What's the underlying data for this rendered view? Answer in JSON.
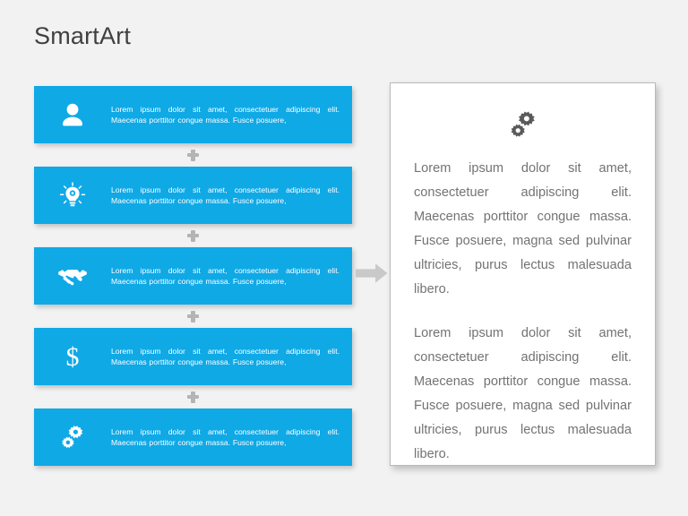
{
  "slide": {
    "title": "SmartArt",
    "background_color": "#f2f2f2",
    "accent_color": "#0fa9e6",
    "text_color": "#737373"
  },
  "left_column": {
    "connector_icon": "plus-icon",
    "steps": [
      {
        "icon": "user-icon",
        "text": "Lorem ipsum dolor sit amet, consectetuer adipiscing elit. Maecenas porttitor congue massa. Fusce posuere,"
      },
      {
        "icon": "lightbulb-icon",
        "text": "Lorem ipsum dolor sit amet, consectetuer adipiscing elit. Maecenas porttitor congue massa. Fusce posuere,"
      },
      {
        "icon": "handshake-icon",
        "text": "Lorem ipsum dolor sit amet, consectetuer adipiscing elit. Maecenas porttitor congue massa. Fusce posuere,"
      },
      {
        "icon": "dollar-icon",
        "text": "Lorem ipsum dolor sit amet, consectetuer adipiscing elit. Maecenas porttitor congue massa. Fusce posuere,"
      },
      {
        "icon": "gears-icon",
        "text": "Lorem ipsum dolor sit amet, consectetuer adipiscing elit. Maecenas porttitor congue massa. Fusce posuere,"
      }
    ]
  },
  "flow": {
    "arrow_icon": "right-arrow-icon",
    "arrow_color": "#c9c9c9"
  },
  "right_panel": {
    "icon": "gears-icon",
    "icon_color": "#5a5a5a",
    "paragraphs": [
      "Lorem ipsum dolor sit amet, consectetuer adipiscing elit. Maecenas porttitor congue massa. Fusce posuere, magna sed pulvinar ultricies, purus lectus malesuada libero.",
      "Lorem ipsum dolor sit amet, consectetuer adipiscing elit. Maecenas porttitor congue massa. Fusce posuere, magna sed pulvinar ultricies, purus lectus malesuada libero."
    ]
  }
}
